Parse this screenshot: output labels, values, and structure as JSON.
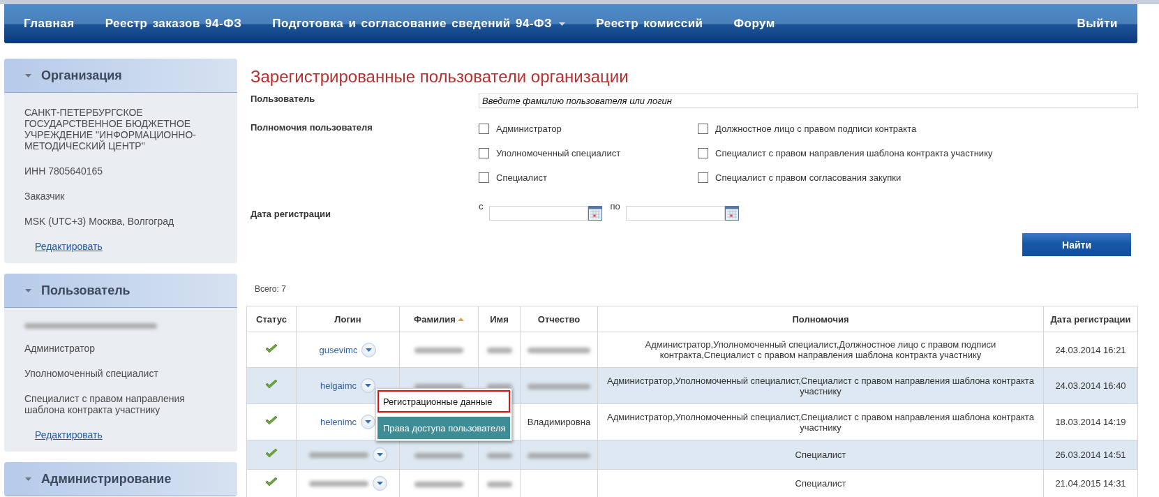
{
  "nav": {
    "items": [
      {
        "label": "Главная",
        "dropdown": false
      },
      {
        "label": "Реестр заказов 94-ФЗ",
        "dropdown": false
      },
      {
        "label": "Подготовка и согласование сведений 94-ФЗ",
        "dropdown": true
      },
      {
        "label": "Реестр комиссий",
        "dropdown": false
      },
      {
        "label": "Форум",
        "dropdown": false
      }
    ],
    "logout": "Выйти"
  },
  "sidebar": [
    {
      "title": "Организация",
      "items": [
        {
          "kind": "text",
          "text": "САНКТ-ПЕТЕРБУРГСКОЕ ГОСУДАРСТВЕННОЕ БЮДЖЕТНОЕ УЧРЕЖДЕНИЕ \"ИНФОРМАЦИОННО-МЕТОДИЧЕСКИЙ ЦЕНТР\""
        },
        {
          "kind": "text",
          "text": "ИНН 7805640165"
        },
        {
          "kind": "text",
          "text": "Заказчик"
        },
        {
          "kind": "text",
          "text": "MSK (UTC+3) Москва, Волгоград"
        },
        {
          "kind": "link",
          "text": "Редактировать"
        }
      ]
    },
    {
      "title": "Пользователь",
      "items": [
        {
          "kind": "redacted"
        },
        {
          "kind": "text",
          "text": "Администратор"
        },
        {
          "kind": "text",
          "text": "Уполномоченный специалист"
        },
        {
          "kind": "text",
          "text": "Специалист с правом направления шаблона контракта участнику"
        },
        {
          "kind": "link",
          "text": "Редактировать"
        }
      ]
    },
    {
      "title": "Администрирование"
    }
  ],
  "main": {
    "title": "Зарегистрированные пользователи организации",
    "user_label": "Пользователь",
    "search_placeholder": "Введите фамилию пользователя или логин",
    "rights_label": "Полномочия пользователя",
    "checkboxes": [
      {
        "label": "Администратор",
        "checked": false
      },
      {
        "label": "Должностное лицо с правом подписи контракта",
        "checked": false
      },
      {
        "label": "Уполномоченный специалист",
        "checked": false
      },
      {
        "label": "Специалист с правом направления шаблона контракта участнику",
        "checked": false
      },
      {
        "label": "Специалист",
        "checked": false
      },
      {
        "label": "Специалист с правом согласования закупки",
        "checked": false
      }
    ],
    "date_label": "Дата регистрации",
    "from_label": "с",
    "to_label": "по",
    "search_button": "Найти",
    "total": "Всего: 7"
  },
  "table": {
    "columns": [
      {
        "label": "Статус",
        "sorted": false
      },
      {
        "label": "Логин",
        "sorted": false
      },
      {
        "label": "Фамилия",
        "sorted": true
      },
      {
        "label": "Имя",
        "sorted": false
      },
      {
        "label": "Отчество",
        "sorted": false
      },
      {
        "label": "Полномочия",
        "sorted": false
      },
      {
        "label": "Дата регистрации",
        "sorted": false
      }
    ],
    "rows": [
      {
        "active": true,
        "login": {
          "text": "gusevimc",
          "redacted": false
        },
        "last_name": {
          "redacted": true
        },
        "first_name": {
          "redacted": true
        },
        "patronymic": {
          "redacted": true
        },
        "rights": "Администратор,Уполномоченный специалист,Должностное лицо с правом подписи контракта,Специалист с правом направления шаблона контракта участнику",
        "date": "24.03.2014 16:21"
      },
      {
        "active": true,
        "login": {
          "text": "helgaimc",
          "redacted": false
        },
        "last_name": {
          "redacted": true
        },
        "first_name": {
          "redacted": true
        },
        "patronymic": {
          "redacted": true
        },
        "rights": "Администратор,Уполномоченный специалист,Специалист с правом направления шаблона контракта участнику",
        "date": "24.03.2014 16:40",
        "menu": [
          {
            "label": "Регистрационные данные",
            "focused": true,
            "selected": false
          },
          {
            "label": "Права доступа пользователя",
            "focused": false,
            "selected": true
          }
        ]
      },
      {
        "active": true,
        "login": {
          "text": "helenimc",
          "redacted": false
        },
        "patronymic": {
          "text": "Владимировна",
          "redacted": false
        },
        "rights": "Администратор,Уполномоченный специалист,Специалист с правом направления шаблона контракта участнику",
        "date": "18.03.2014 14:19"
      },
      {
        "active": true,
        "login": {
          "redacted": true
        },
        "last_name": {
          "redacted": true
        },
        "first_name": {
          "redacted": true
        },
        "patronymic": {
          "redacted": true
        },
        "rights": "Специалист",
        "date": "26.03.2014 14:51"
      },
      {
        "active": true,
        "login": {
          "redacted": true
        },
        "last_name": {
          "redacted": true
        },
        "first_name": {
          "redacted": true
        },
        "rights": "Специалист",
        "date": "21.04.2015 14:31"
      }
    ]
  }
}
